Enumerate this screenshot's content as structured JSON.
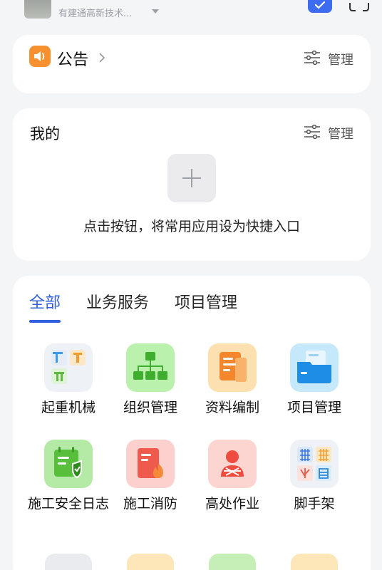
{
  "header": {
    "company_name": "有建通高新技术...",
    "avatar_icon": "avatar-image",
    "todo_icon": "todo-check-icon",
    "scan_icon": "scan-icon"
  },
  "notice": {
    "title": "公告",
    "manage_label": "管理",
    "icon": "speaker-icon",
    "accent": "#f7902f"
  },
  "mine": {
    "title": "我的",
    "manage_label": "管理",
    "hint": "点击按钮，将常用应用设为快捷入口"
  },
  "tabs": [
    {
      "label": "全部",
      "active": true
    },
    {
      "label": "业务服务",
      "active": false
    },
    {
      "label": "项目管理",
      "active": false
    }
  ],
  "apps": [
    {
      "label": "起重机械",
      "icon": "crane-machinery-icon"
    },
    {
      "label": "组织管理",
      "icon": "org-chart-icon"
    },
    {
      "label": "资料编制",
      "icon": "document-edit-icon"
    },
    {
      "label": "项目管理",
      "icon": "folder-icon"
    },
    {
      "label": "施工安全日志",
      "icon": "safety-log-icon"
    },
    {
      "label": "施工消防",
      "icon": "fire-safety-icon"
    },
    {
      "label": "高处作业",
      "icon": "height-work-icon"
    },
    {
      "label": "脚手架",
      "icon": "scaffold-icon"
    }
  ],
  "colors": {
    "accent_blue": "#2f5fe0",
    "notice_orange": "#f7902f"
  }
}
